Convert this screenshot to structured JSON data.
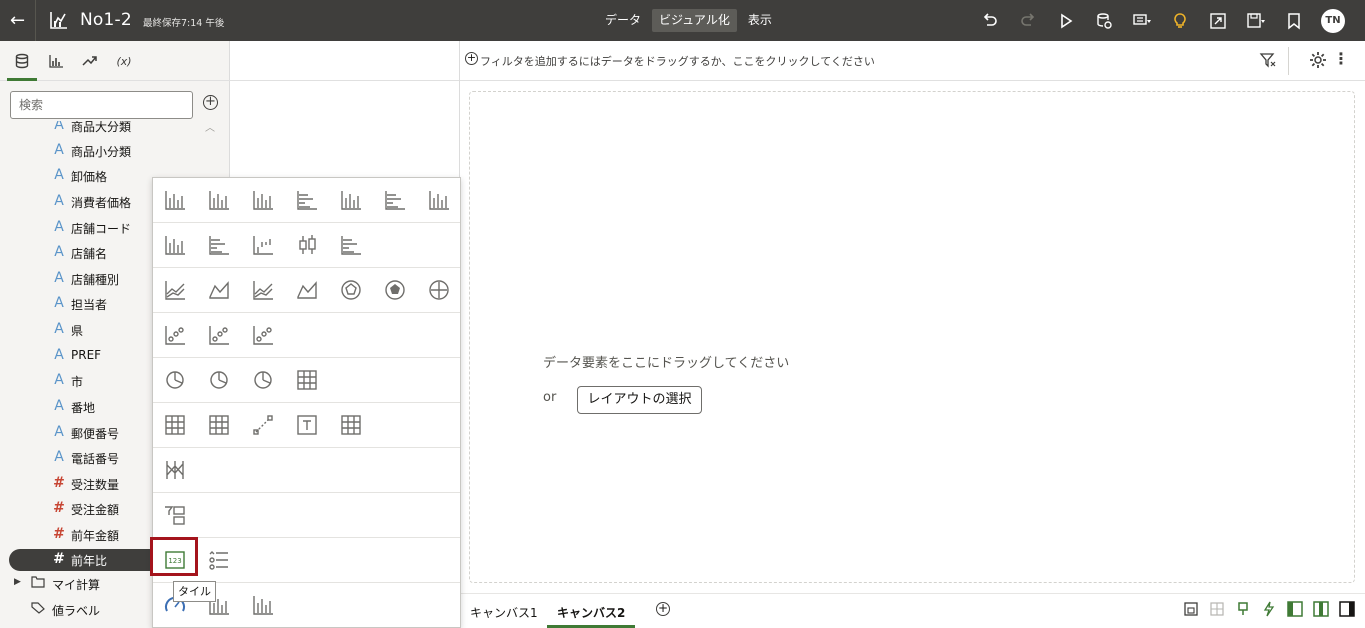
{
  "app": {
    "back_icon": "arrow-left-icon",
    "project_title": "No1-2",
    "saved_status": "最終保存7:14 午後",
    "tabs": [
      {
        "label": "データ",
        "active": false
      },
      {
        "label": "ビジュアル化",
        "active": true
      },
      {
        "label": "表示",
        "active": false
      }
    ],
    "user_initials": "TN",
    "toolbar_icons": [
      "undo-icon",
      "redo-icon",
      "play-icon",
      "refresh-data-icon",
      "comment-menu-icon",
      "lightbulb-icon",
      "export-icon",
      "save-menu-icon",
      "bookmark-icon"
    ]
  },
  "left_panel": {
    "tabs": [
      {
        "name": "data-tab",
        "icon": "database-icon",
        "active": true
      },
      {
        "name": "visualizations-tab",
        "icon": "bar-chart-icon",
        "active": false
      },
      {
        "name": "analytics-tab",
        "icon": "trend-icon",
        "active": false
      },
      {
        "name": "expression-tab",
        "label": "(x)",
        "active": false
      }
    ],
    "search_placeholder": "検索",
    "fields": [
      {
        "type": "A",
        "label": "商品大分類"
      },
      {
        "type": "A",
        "label": "商品小分類"
      },
      {
        "type": "A",
        "label": "卸価格"
      },
      {
        "type": "A",
        "label": "消費者価格"
      },
      {
        "type": "A",
        "label": "店舗コード"
      },
      {
        "type": "A",
        "label": "店舗名"
      },
      {
        "type": "A",
        "label": "店舗種別"
      },
      {
        "type": "A",
        "label": "担当者"
      },
      {
        "type": "A",
        "label": "県"
      },
      {
        "type": "A",
        "label": "PREF"
      },
      {
        "type": "A",
        "label": "市"
      },
      {
        "type": "A",
        "label": "番地"
      },
      {
        "type": "A",
        "label": "郵便番号"
      },
      {
        "type": "A",
        "label": "電話番号"
      },
      {
        "type": "#",
        "label": "受注数量"
      },
      {
        "type": "#",
        "label": "受注金額"
      },
      {
        "type": "#",
        "label": "前年金額"
      },
      {
        "type": "#",
        "label": "前年比",
        "selected": true
      }
    ],
    "folders": [
      {
        "label": "マイ計算"
      },
      {
        "label": "値ラベル"
      }
    ]
  },
  "filter_bar": {
    "placeholder": "フィルタを追加するにはデータをドラッグするか、ここをクリックしてください"
  },
  "canvas": {
    "drop_message": "データ要素をここにドラッグしてください",
    "or_label": "or",
    "layout_button": "レイアウトの選択",
    "tabs": [
      {
        "label": "キャンバス1",
        "active": false
      },
      {
        "label": "キャンバス2",
        "active": true
      }
    ]
  },
  "viz_popup": {
    "tooltip": "タイル",
    "selected": "tile-icon",
    "rows": [
      [
        "bar-icon",
        "grouped-bar-icon",
        "stacked-bar-icon",
        "horizontal-bar-icon",
        "horizontal-stacked-bar-icon",
        "horizontal-100-bar-icon",
        "bar-line-icon"
      ],
      [
        "combo-icon",
        "horizontal-grouped-icon",
        "waterfall-icon",
        "boxplot-icon",
        "horizontal-boxplot-icon"
      ],
      [
        "line-icon",
        "area-icon",
        "radar-line-icon",
        "stacked-area-icon",
        "radar-icon",
        "radar-filled-icon",
        "radar-pie-icon"
      ],
      [
        "scatter-icon",
        "grid-scatter-icon",
        "dot-plot-icon"
      ],
      [
        "pie-icon",
        "donut-icon",
        "sunburst-icon",
        "treemap-icon"
      ],
      [
        "table-icon",
        "pivot-icon",
        "network-icon",
        "text-box-icon",
        "tile-grid-icon"
      ],
      [
        "parallel-icon"
      ],
      [
        "filter-list-icon"
      ],
      [
        "tile-icon",
        "list-icon"
      ],
      [
        "gauge-icon",
        "histogram-icon",
        "bar-chart-small-icon"
      ]
    ]
  },
  "colors": {
    "topbar": "#3f3e3c",
    "accent_green": "#3f7a35",
    "attribute_blue": "#5a94c9",
    "measure_red": "#c74634",
    "highlight_red": "#a4141c"
  }
}
